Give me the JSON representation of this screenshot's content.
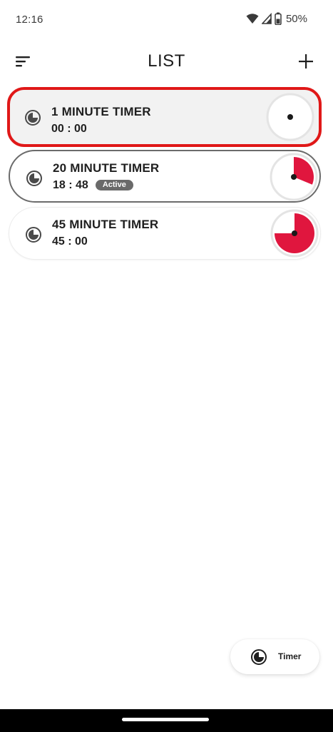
{
  "status_bar": {
    "time": "12:16",
    "battery_percent": "50%",
    "icons": [
      "wifi-icon",
      "cellular-signal-icon",
      "battery-icon"
    ]
  },
  "app_bar": {
    "title": "LIST",
    "menu_icon": "menu-icon",
    "add_icon": "add-icon"
  },
  "timers": [
    {
      "title": "1 MINUTE TIMER",
      "remaining": "00 : 00",
      "active": false,
      "badge": "",
      "dial_fraction": 0.0,
      "selected": true
    },
    {
      "title": "20 MINUTE TIMER",
      "remaining": "18 : 48",
      "active": true,
      "badge": "Active",
      "dial_fraction": 0.313,
      "selected": false
    },
    {
      "title": "45 MINUTE TIMER",
      "remaining": "45 : 00",
      "active": false,
      "badge": "",
      "dial_fraction": 0.75,
      "selected": false
    }
  ],
  "bottom_chip": {
    "label": "Timer",
    "icon": "timer-icon"
  },
  "colors": {
    "dial_fill": "#e0163e",
    "selection_border": "#e01818",
    "active_border": "#6b6b6b",
    "badge_bg": "#6a6a6a"
  }
}
